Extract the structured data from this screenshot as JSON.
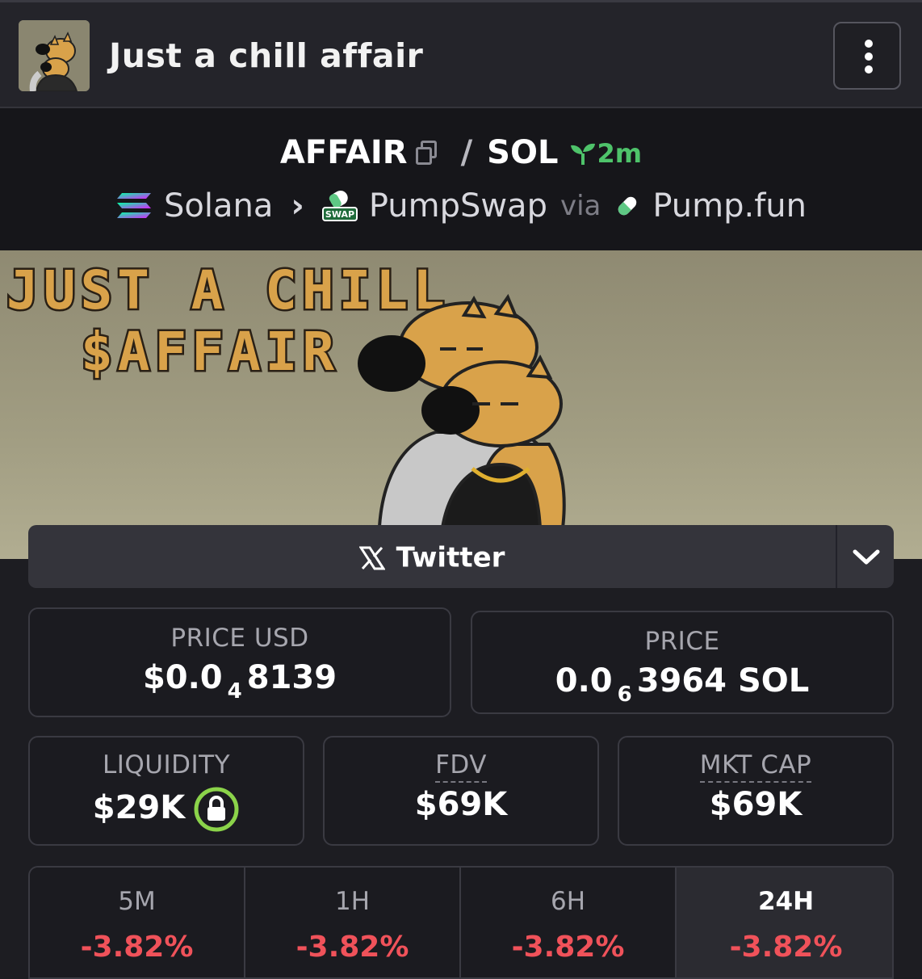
{
  "header": {
    "title": "Just a chill affair"
  },
  "pair": {
    "base": "AFFAIR",
    "quote": "SOL",
    "separator": "/",
    "age": "2m",
    "chain": "Solana",
    "dex": "PumpSwap",
    "dex_badge": "SWAP",
    "via_label": "via",
    "launchpad": "Pump.fun"
  },
  "banner": {
    "line1": "JUST A CHILL",
    "line2": "$AFFAIR"
  },
  "links": {
    "twitter_label": "Twitter"
  },
  "stats": {
    "price_usd": {
      "label": "PRICE USD",
      "prefix": "$0.0",
      "zeros": "4",
      "digits": "8139"
    },
    "price_native": {
      "label": "PRICE",
      "prefix": "0.0",
      "zeros": "6",
      "digits": "3964 SOL"
    },
    "liquidity": {
      "label": "LIQUIDITY",
      "value": "$29K"
    },
    "fdv": {
      "label": "FDV",
      "value": "$69K"
    },
    "mkt_cap": {
      "label": "MKT CAP",
      "value": "$69K"
    }
  },
  "timeframes": [
    {
      "label": "5M",
      "change": "-3.82%"
    },
    {
      "label": "1H",
      "change": "-3.82%"
    },
    {
      "label": "6H",
      "change": "-3.82%"
    },
    {
      "label": "24H",
      "change": "-3.82%"
    }
  ],
  "colors": {
    "positive_green": "#4ec36a",
    "negative_red": "#f0525a",
    "background": "#1d1d22",
    "banner": "#9e9a80"
  },
  "icons": [
    "kebab-menu-icon",
    "copy-icon",
    "sprout-icon",
    "solana-icon",
    "chevron-right-icon",
    "pumpswap-icon",
    "pill-icon",
    "x-logo-icon",
    "chevron-down-icon",
    "lock-icon"
  ]
}
